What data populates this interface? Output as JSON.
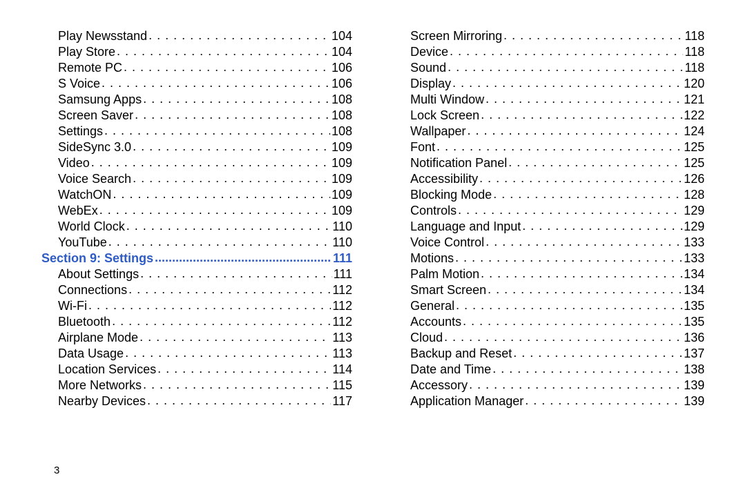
{
  "page_number": "3",
  "left": [
    {
      "label": "Play Newsstand",
      "page": "104"
    },
    {
      "label": "Play Store",
      "page": "104"
    },
    {
      "label": "Remote PC",
      "page": "106"
    },
    {
      "label": "S Voice",
      "page": "106"
    },
    {
      "label": "Samsung Apps",
      "page": "108"
    },
    {
      "label": "Screen Saver",
      "page": "108"
    },
    {
      "label": "Settings",
      "page": "108"
    },
    {
      "label": "SideSync 3.0",
      "page": "109"
    },
    {
      "label": "Video",
      "page": "109"
    },
    {
      "label": "Voice Search",
      "page": "109"
    },
    {
      "label": "WatchON",
      "page": "109"
    },
    {
      "label": "WebEx",
      "page": "109"
    },
    {
      "label": "World Clock",
      "page": "110"
    },
    {
      "label": "YouTube",
      "page": "110"
    },
    {
      "label": "Section 9:  Settings",
      "page": "111",
      "section": true
    },
    {
      "label": "About Settings",
      "page": "111"
    },
    {
      "label": "Connections",
      "page": "112"
    },
    {
      "label": "Wi-Fi",
      "page": "112"
    },
    {
      "label": "Bluetooth",
      "page": "112"
    },
    {
      "label": "Airplane Mode",
      "page": "113"
    },
    {
      "label": "Data Usage",
      "page": "113"
    },
    {
      "label": "Location Services",
      "page": "114"
    },
    {
      "label": "More Networks",
      "page": "115"
    },
    {
      "label": "Nearby Devices",
      "page": "117"
    }
  ],
  "right": [
    {
      "label": "Screen Mirroring",
      "page": "118"
    },
    {
      "label": "Device",
      "page": "118"
    },
    {
      "label": "Sound",
      "page": "118"
    },
    {
      "label": "Display",
      "page": "120"
    },
    {
      "label": "Multi Window",
      "page": "121"
    },
    {
      "label": "Lock Screen",
      "page": "122"
    },
    {
      "label": "Wallpaper",
      "page": "124"
    },
    {
      "label": "Font",
      "page": "125"
    },
    {
      "label": "Notification Panel",
      "page": "125"
    },
    {
      "label": "Accessibility",
      "page": "126"
    },
    {
      "label": "Blocking Mode",
      "page": "128"
    },
    {
      "label": "Controls",
      "page": "129"
    },
    {
      "label": "Language and Input",
      "page": "129"
    },
    {
      "label": "Voice Control",
      "page": "133"
    },
    {
      "label": "Motions",
      "page": "133"
    },
    {
      "label": "Palm Motion",
      "page": "134"
    },
    {
      "label": "Smart Screen",
      "page": "134"
    },
    {
      "label": "General",
      "page": "135"
    },
    {
      "label": "Accounts",
      "page": "135"
    },
    {
      "label": "Cloud",
      "page": "136"
    },
    {
      "label": "Backup and Reset",
      "page": "137"
    },
    {
      "label": "Date and Time",
      "page": "138"
    },
    {
      "label": "Accessory",
      "page": "139"
    },
    {
      "label": "Application Manager",
      "page": "139"
    }
  ]
}
